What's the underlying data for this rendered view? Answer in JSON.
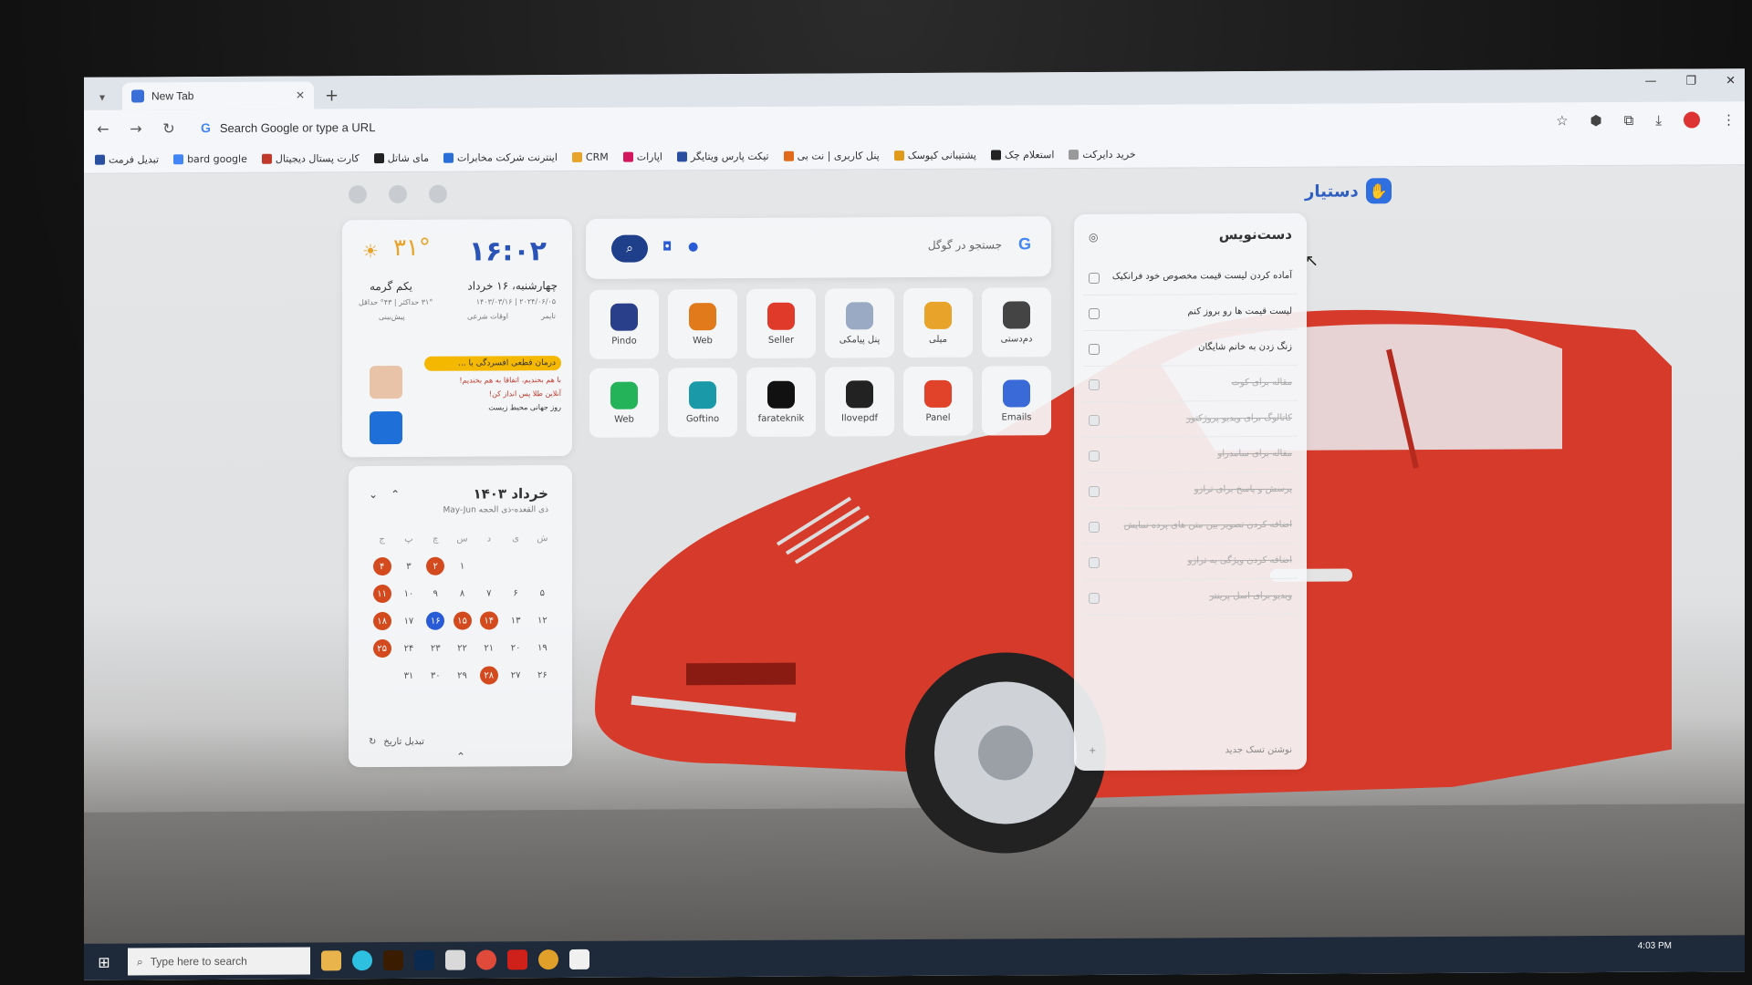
{
  "browser": {
    "tab_title": "New Tab",
    "omnibox_placeholder": "Search Google or type a URL",
    "bookmarks": [
      {
        "label": "خرید دایرکت",
        "color": "#999999"
      },
      {
        "label": "استعلام چک",
        "color": "#222222"
      },
      {
        "label": "پشتیبانی کیوسک",
        "color": "#e09a1a"
      },
      {
        "label": "پنل کاربری | نت بی",
        "color": "#e06a1a"
      },
      {
        "label": "تیکت پارس ویتایگر",
        "color": "#2a4fa0"
      },
      {
        "label": "اپارات",
        "color": "#d2175e"
      },
      {
        "label": "CRM",
        "color": "#e8a42a"
      },
      {
        "label": "اینترنت شرکت مخابرات",
        "color": "#2a6fd8"
      },
      {
        "label": "مای شاتل",
        "color": "#222222"
      },
      {
        "label": "کارت پستال دیجیتال",
        "color": "#c0392b"
      },
      {
        "label": "bard google",
        "color": "#4285f4"
      },
      {
        "label": "تبدیل فرمت",
        "color": "#2a4fa0"
      }
    ]
  },
  "brand": {
    "name": "دستیار"
  },
  "clock": {
    "time": "۱۶:۰۲",
    "date": "چهارشنبه، ۱۶ خرداد",
    "sub": "۲۰۲۴/۰۶/۰۵ | ۱۴۰۳/۰۳/۱۶",
    "timer": "تایمر",
    "prayer": "اوقات شرعی"
  },
  "weather": {
    "temp": "۳۱°",
    "desc": "یکم گرمه",
    "range": "۳۱° حداکثر | ۴۳° حداقل",
    "forecast": "پیش‌بینی"
  },
  "news": {
    "badge": "درمان قطعی افسردگی با ...",
    "lines": [
      "با هم بخندیم، اتفاقا به هم بخندیم!",
      "آنلاین طلا پس انداز کن!",
      "روز جهانی محیط زیست"
    ]
  },
  "calendar": {
    "title": "خرداد ۱۴۰۳",
    "sub": "ذی القعده-ذی الحجه  May-Jun",
    "weekdays": [
      "ش",
      "ی",
      "د",
      "س",
      "چ",
      "پ",
      "ج"
    ],
    "rows": [
      [
        "",
        "",
        "",
        "۱",
        "۲",
        "۳",
        "۴"
      ],
      [
        "۵",
        "۶",
        "۷",
        "۸",
        "۹",
        "۱۰",
        "۱۱"
      ],
      [
        "۱۲",
        "۱۳",
        "۱۴",
        "۱۵",
        "۱۶",
        "۱۷",
        "۱۸"
      ],
      [
        "۱۹",
        "۲۰",
        "۲۱",
        "۲۲",
        "۲۳",
        "۲۴",
        "۲۵"
      ],
      [
        "۲۶",
        "۲۷",
        "۲۸",
        "۲۹",
        "۳۰",
        "۳۱",
        ""
      ]
    ],
    "holidays": [
      "۲",
      "۴",
      "۱۱",
      "۱۴",
      "۱۵",
      "۱۸",
      "۲۵",
      "۲۸"
    ],
    "today": "۱۶",
    "footer": "تبدیل تاریخ"
  },
  "search": {
    "placeholder": "جستجو در گوگل"
  },
  "apps": [
    {
      "label": "دم‌دستی",
      "icon": "grid-icon",
      "color": "#444444"
    },
    {
      "label": "میلی",
      "icon": "milli-icon",
      "color": "#e8a42a"
    },
    {
      "label": "پنل پیامکی",
      "icon": "sms-icon",
      "color": "#9aa9c4"
    },
    {
      "label": "Seller",
      "icon": "seller-icon",
      "color": "#e03a2a"
    },
    {
      "label": "Web",
      "icon": "web-icon",
      "color": "#e07a1a"
    },
    {
      "label": "Pindo",
      "icon": "pindo-icon",
      "color": "#2a3f8a"
    },
    {
      "label": "Emails",
      "icon": "emails-icon",
      "color": "#3a6ad8"
    },
    {
      "label": "Panel",
      "icon": "panel-icon",
      "color": "#e0432a"
    },
    {
      "label": "Ilovepdf",
      "icon": "pdf-icon",
      "color": "#222222"
    },
    {
      "label": "farateknik",
      "icon": "farateknik-icon",
      "color": "#111111"
    },
    {
      "label": "Goftino",
      "icon": "goftino-icon",
      "color": "#1a9aa8"
    },
    {
      "label": "Web",
      "icon": "whatsapp-icon",
      "color": "#25b35a"
    }
  ],
  "todo": {
    "title": "دست‌نویس",
    "items": [
      {
        "text": "آماده کردن لیست قیمت مخصوص خود فرانکیک",
        "done": false
      },
      {
        "text": "لیست قیمت ها رو بروز کنم",
        "done": false
      },
      {
        "text": "زنگ زدن به خانم شایگان",
        "done": false
      },
      {
        "text": "مقاله برای کوت",
        "done": true
      },
      {
        "text": "کاتالوگ برای ویدیو پروژکتور",
        "done": true
      },
      {
        "text": "مقاله برای سامدراو",
        "done": true
      },
      {
        "text": "پرسش و پاسخ برای ترازو",
        "done": true
      },
      {
        "text": "اضافه کردن تصویر بین متن های پرده نمایش",
        "done": true
      },
      {
        "text": "اضافه کردن ویژگی به ترازو",
        "done": true
      },
      {
        "text": "ویدیو برای اسل پرینتر",
        "done": true
      }
    ],
    "add_label": "نوشتن تسک جدید"
  },
  "taskbar": {
    "search_placeholder": "Type here to search",
    "time": "4:03 PM"
  }
}
